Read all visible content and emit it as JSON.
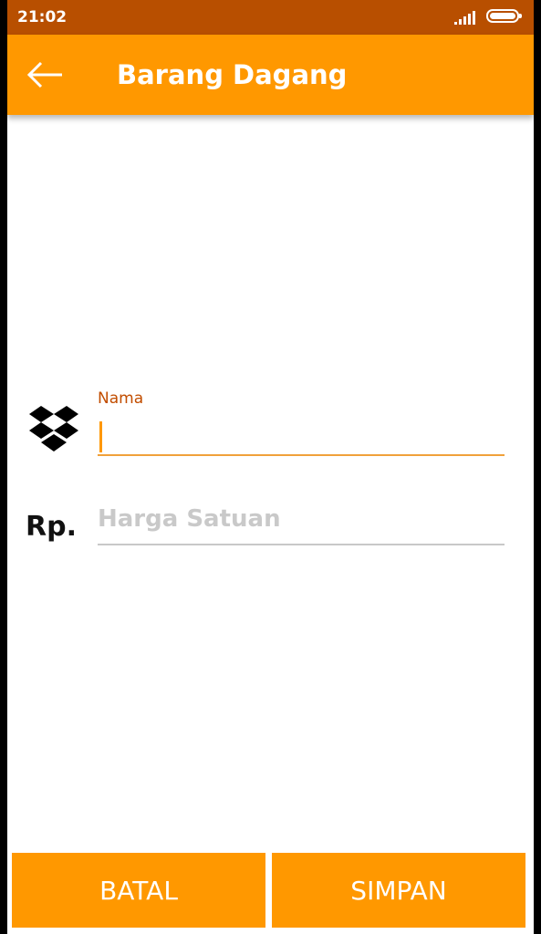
{
  "status_bar": {
    "time": "21:02"
  },
  "app_bar": {
    "title": "Barang Dagang",
    "back_icon": "arrow-left-icon"
  },
  "form": {
    "nama": {
      "label": "Nama",
      "value": "",
      "icon": "package-box-icon"
    },
    "harga": {
      "prefix": "Rp.",
      "placeholder": "Harga Satuan",
      "value": ""
    }
  },
  "buttons": {
    "cancel": "BATAL",
    "save": "SIMPAN"
  },
  "colors": {
    "primary": "#ff9800",
    "status_bar": "#b84f00",
    "label": "#c24d00"
  }
}
